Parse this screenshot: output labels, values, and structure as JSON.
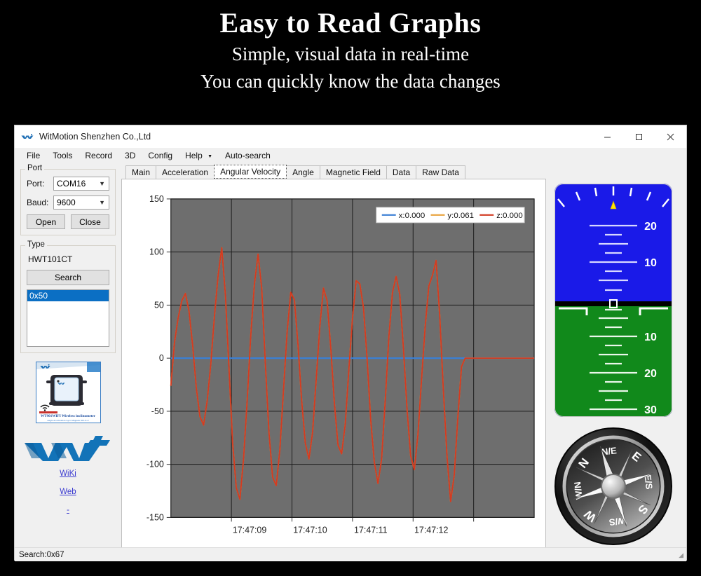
{
  "promo": {
    "title": "Easy to Read Graphs",
    "subtitle_line1": "Simple, visual data in real-time",
    "subtitle_line2": "You can quickly know the data changes"
  },
  "window": {
    "title": "WitMotion Shenzhen Co.,Ltd",
    "minimize_label": "─",
    "maximize_label": "□",
    "close_label": "✕"
  },
  "menubar": {
    "items": [
      {
        "label": "File"
      },
      {
        "label": "Tools"
      },
      {
        "label": "Record"
      },
      {
        "label": "3D"
      },
      {
        "label": "Config"
      },
      {
        "label": "Help",
        "has_caret": true
      },
      {
        "label": "Auto-search"
      }
    ]
  },
  "sidebar": {
    "port_group": {
      "legend": "Port",
      "port_label": "Port:",
      "port_value": "COM16",
      "baud_label": "Baud:",
      "baud_value": "9600",
      "open_label": "Open",
      "close_label": "Close"
    },
    "type_group": {
      "legend": "Type",
      "device_model": "HWT101CT",
      "search_label": "Search",
      "devices": [
        "0x50"
      ],
      "selected_device": "0x50"
    },
    "product_image": {
      "brand": "WIT",
      "caption": "WT901WIFI  Wireless inclinometer",
      "subcaption": "Angle Acceleration Gyro Magnetic RS-X-Z"
    },
    "logo_alt": "WIT",
    "links": [
      {
        "label": "WiKi"
      },
      {
        "label": "Web"
      },
      {
        "label": "-"
      }
    ]
  },
  "tabs": [
    {
      "label": "Main",
      "active": false
    },
    {
      "label": "Acceleration",
      "active": false
    },
    {
      "label": "Angular Velocity",
      "active": true
    },
    {
      "label": "Angle",
      "active": false
    },
    {
      "label": "Magnetic Field",
      "active": false
    },
    {
      "label": "Data",
      "active": false
    },
    {
      "label": "Raw Data",
      "active": false
    }
  ],
  "chart_data": {
    "type": "line",
    "title": "",
    "xlabel": "",
    "ylabel": "",
    "ylim": [
      -150,
      150
    ],
    "yticks": [
      150,
      100,
      50,
      0,
      -50,
      -100,
      -150
    ],
    "xticks": [
      "17:47:09",
      "17:47:10",
      "17:47:11",
      "17:47:12"
    ],
    "grid": true,
    "plot_background": "#6e6e6e",
    "legend_position": "top-right",
    "series": [
      {
        "name": "x:0.000",
        "key": "x",
        "color": "#3b7fd4",
        "current_value": 0.0,
        "values": [
          0,
          0,
          0,
          0,
          0,
          0,
          0,
          0,
          0,
          0,
          0,
          0,
          0,
          0,
          0,
          0,
          0,
          0,
          0,
          0,
          0,
          0,
          0,
          0,
          0,
          0,
          0,
          0,
          0,
          0,
          0,
          0,
          0,
          0,
          0,
          0,
          0,
          0,
          0,
          0,
          0,
          0,
          0,
          0,
          0,
          0,
          0,
          0,
          0,
          0,
          0,
          0,
          0,
          0,
          0,
          0,
          0,
          0,
          0,
          0,
          0,
          0,
          0,
          0,
          0,
          0,
          0,
          0,
          0,
          0,
          0,
          0,
          0,
          0,
          0,
          0,
          0,
          0,
          0,
          0,
          0,
          0,
          0,
          0,
          0,
          0,
          0,
          0,
          0,
          0,
          0,
          0,
          0,
          0,
          0,
          0,
          0,
          0,
          0,
          0
        ]
      },
      {
        "name": "y:0.061",
        "key": "y",
        "color": "#e8a33d",
        "current_value": 0.061,
        "values": [
          -26,
          15,
          38,
          54,
          61,
          44,
          12,
          -28,
          -55,
          -63,
          -40,
          -5,
          40,
          78,
          104,
          60,
          -10,
          -80,
          -122,
          -133,
          -95,
          -40,
          22,
          70,
          98,
          66,
          -5,
          -70,
          -112,
          -120,
          -86,
          -30,
          25,
          62,
          55,
          12,
          -40,
          -80,
          -95,
          -70,
          -20,
          30,
          66,
          54,
          10,
          -42,
          -82,
          -90,
          -62,
          -10,
          38,
          73,
          70,
          48,
          0,
          -58,
          -98,
          -118,
          -95,
          -40,
          20,
          62,
          77,
          60,
          10,
          -48,
          -92,
          -105,
          -72,
          -20,
          30,
          68,
          78,
          92,
          40,
          -30,
          -92,
          -135,
          -110,
          -55,
          -8,
          0,
          0,
          0,
          0,
          0,
          0,
          0,
          0,
          0,
          0,
          0,
          0,
          0,
          0,
          0,
          0,
          0,
          0,
          0,
          0
        ]
      },
      {
        "name": "z:0.000",
        "key": "z",
        "color": "#d23b22",
        "current_value": 0.0,
        "values": [
          -26,
          15,
          38,
          54,
          61,
          44,
          12,
          -28,
          -55,
          -63,
          -40,
          -5,
          40,
          78,
          104,
          60,
          -10,
          -80,
          -122,
          -133,
          -95,
          -40,
          22,
          70,
          98,
          66,
          -5,
          -70,
          -112,
          -120,
          -86,
          -30,
          25,
          62,
          55,
          12,
          -40,
          -80,
          -95,
          -70,
          -20,
          30,
          66,
          54,
          10,
          -42,
          -82,
          -90,
          -62,
          -10,
          38,
          73,
          70,
          48,
          0,
          -58,
          -98,
          -118,
          -95,
          -40,
          20,
          62,
          77,
          60,
          10,
          -48,
          -92,
          -105,
          -72,
          -20,
          30,
          68,
          78,
          92,
          40,
          -30,
          -92,
          -135,
          -110,
          -55,
          -8,
          0,
          0,
          0,
          0,
          0,
          0,
          0,
          0,
          0,
          0,
          0,
          0,
          0,
          0,
          0,
          0,
          0,
          0,
          0,
          0
        ]
      }
    ]
  },
  "gauges": {
    "attitude": {
      "sky_color": "#1a1ae8",
      "ground_color": "#11891b",
      "sky_marks": [
        "20",
        "10"
      ],
      "ground_marks": [
        "10",
        "20",
        "30"
      ]
    },
    "compass": {
      "cardinals": [
        "N",
        "E",
        "S",
        "W"
      ]
    }
  },
  "statusbar": {
    "text": "Search:0x67"
  }
}
